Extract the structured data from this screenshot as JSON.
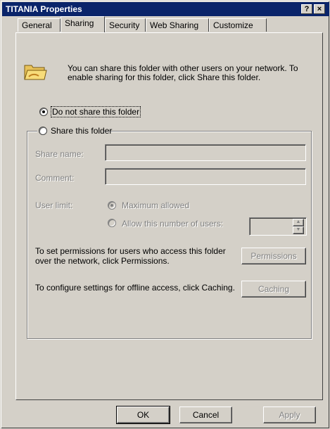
{
  "window": {
    "title": "TITANIA Properties",
    "help_label": "?",
    "close_label": "×"
  },
  "tabs": [
    {
      "label": "General"
    },
    {
      "label": "Sharing"
    },
    {
      "label": "Security"
    },
    {
      "label": "Web Sharing"
    },
    {
      "label": "Customize"
    }
  ],
  "sharing": {
    "info_text": "You can share this folder with other users on your network.  To enable sharing for this folder, click Share this folder.",
    "do_not_share_label": "Do not share this folder",
    "share_label": "Share this folder",
    "share_name_label": "Share name:",
    "share_name_value": "",
    "comment_label": "Comment:",
    "comment_value": "",
    "user_limit_label": "User limit:",
    "max_allowed_label": "Maximum allowed",
    "allow_number_label": "Allow this number of users:",
    "allow_number_value": "",
    "permissions_text": "To set permissions for users who access this folder over the network, click Permissions.",
    "permissions_button": "Permissions",
    "offline_text": "To configure settings for offline access, click Caching.",
    "caching_button": "Caching"
  },
  "buttons": {
    "ok": "OK",
    "cancel": "Cancel",
    "apply": "Apply"
  }
}
